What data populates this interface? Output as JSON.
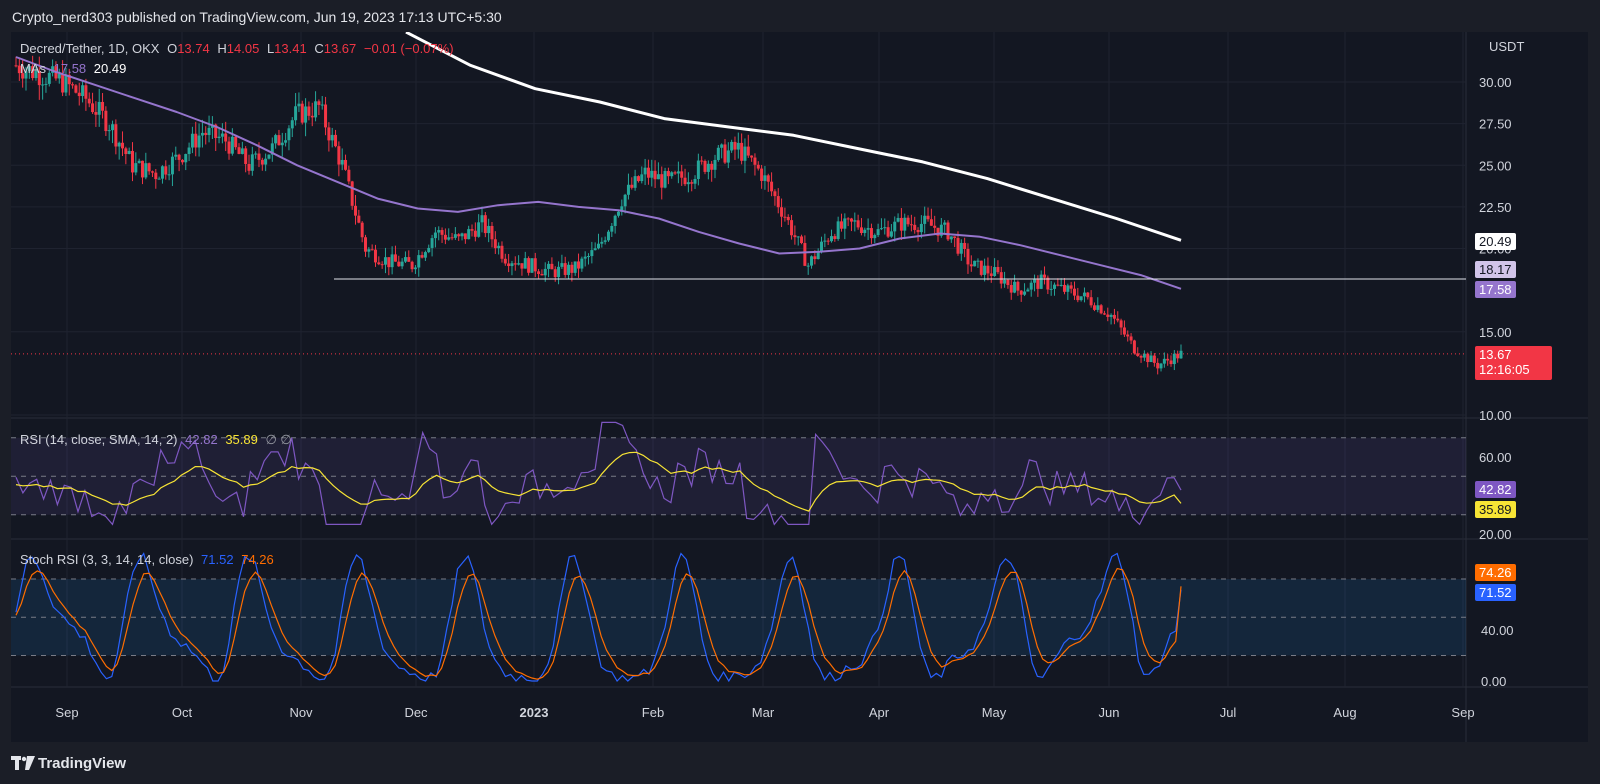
{
  "header": {
    "published": "Crypto_nerd303 published on TradingView.com, Jun 19, 2023 17:13 UTC+5:30"
  },
  "footer": {
    "brand": "TradingView"
  },
  "legend": {
    "symbol": "Decred/Tether, 1D, OKX",
    "o_label": "O",
    "o": "13.74",
    "h_label": "H",
    "h": "14.05",
    "l_label": "L",
    "l": "13.41",
    "c_label": "C",
    "c": "13.67",
    "change": "−0.01 (−0.07%)",
    "ma_label": "MAs",
    "ma1": "17.58",
    "ma2": "20.49",
    "rsi_label": "RSI (14, close, SMA, 14, 2)",
    "rsi": "42.82",
    "rsi_ma": "35.89",
    "rsi_nulls": "∅ ∅",
    "stoch_label": "Stoch RSI (3, 3, 14, 14, close)",
    "stoch_k": "71.52",
    "stoch_d": "74.26"
  },
  "price_axis": {
    "currency": "USDT",
    "ticks": [
      "30.00",
      "27.50",
      "25.00",
      "22.50",
      "20.00",
      "15.00",
      "10.00"
    ],
    "tag_ma200": "20.49",
    "tag_line": "18.17",
    "tag_ma100": "17.58",
    "tag_last": "13.67",
    "tag_countdown": "12:16:05"
  },
  "rsi_axis": {
    "ticks": [
      "60.00",
      "20.00"
    ],
    "tag_rsi": "42.82",
    "tag_ma": "35.89"
  },
  "stoch_axis": {
    "ticks": [
      "40.00",
      "0.00"
    ],
    "tag_d": "74.26",
    "tag_k": "71.52"
  },
  "time_axis": {
    "labels": [
      "Sep",
      "Oct",
      "Nov",
      "Dec",
      "2023",
      "Feb",
      "Mar",
      "Apr",
      "May",
      "Jun",
      "Jul",
      "Aug",
      "Sep"
    ]
  },
  "colors": {
    "up": "#26a69a",
    "down": "#f23645",
    "ma100": "#9575cd",
    "ma200": "#ffffff",
    "rsi": "#7e57c2",
    "rsi_ma": "#f7e435",
    "stoch_k": "#2962ff",
    "stoch_d": "#ff6d00"
  },
  "chart_data": {
    "type": "candlestick",
    "title": "Decred/Tether, 1D, OKX",
    "ylim": [
      9.5,
      33
    ],
    "support_level": 18.17,
    "last_price": 13.67,
    "candles_x_start_date": "2022-08-20",
    "candles_weekly_close": [
      31.0,
      30.5,
      30.0,
      29.0,
      27.5,
      25.0,
      24.5,
      25.5,
      27.0,
      26.5,
      25.0,
      26.0,
      28.0,
      28.5,
      25.0,
      20.0,
      19.2,
      19.0,
      21.0,
      20.5,
      21.5,
      19.5,
      19.0,
      18.6,
      18.8,
      20.0,
      23.0,
      24.5,
      24.0,
      24.5,
      25.5,
      26.0,
      24.5,
      22.0,
      19.0,
      21.0,
      21.5,
      21.0,
      21.5,
      21.5,
      21.0,
      19.0,
      18.5,
      17.5,
      18.0,
      17.5,
      17.0,
      16.0,
      14.0,
      13.0,
      13.67
    ],
    "ma100": [
      31.5,
      30.6,
      29.8,
      29.0,
      28.2,
      27.3,
      26.2,
      25.0,
      24.0,
      23.0,
      22.4,
      22.2,
      22.6,
      22.8,
      22.5,
      22.3,
      21.8,
      21.0,
      20.3,
      19.7,
      19.8,
      20.0,
      20.6,
      20.9,
      20.7,
      20.2,
      19.6,
      19.0,
      18.4,
      17.58
    ],
    "ma200_visible": [
      33,
      31,
      29.6,
      28.8,
      27.8,
      27.3,
      26.8,
      26.0,
      25.2,
      24.2,
      23.0,
      21.8,
      20.49
    ],
    "rsi": {
      "last": 42.82,
      "ma_last": 35.89,
      "bands": [
        70,
        30
      ]
    },
    "stoch_rsi": {
      "k_last": 71.52,
      "d_last": 74.26,
      "bands": [
        80,
        20
      ]
    }
  }
}
